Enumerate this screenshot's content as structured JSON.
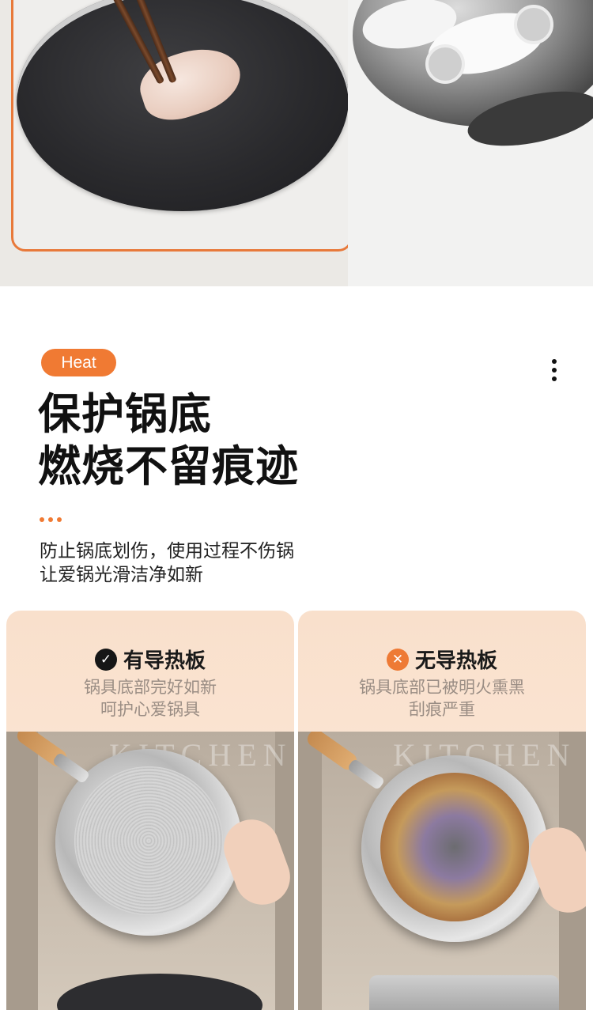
{
  "tag": {
    "label": "Heat"
  },
  "headline": {
    "line1": "保护锅底",
    "line2": "燃烧不留痕迹"
  },
  "description": {
    "line1": "防止锅底划伤，使用过程不伤锅",
    "line2": "让爱锅光滑洁净如新"
  },
  "comparison": {
    "with_plate": {
      "icon": "check-circle-icon",
      "title": "有导热板",
      "sub1": "锅具底部完好如新",
      "sub2": "呵护心爱锅具"
    },
    "without_plate": {
      "icon": "x-circle-icon",
      "title": "无导热板",
      "sub1": "锅具底部已被明火熏黑",
      "sub2": "刮痕严重"
    }
  },
  "photo_text": {
    "apron_left": "KITCHEN",
    "apron_right": "KITCHEN"
  },
  "colors": {
    "accent": "#f07a33",
    "card_bg": "#f9e0cc",
    "text_dark": "#111111",
    "text_muted": "#9a8d84"
  }
}
